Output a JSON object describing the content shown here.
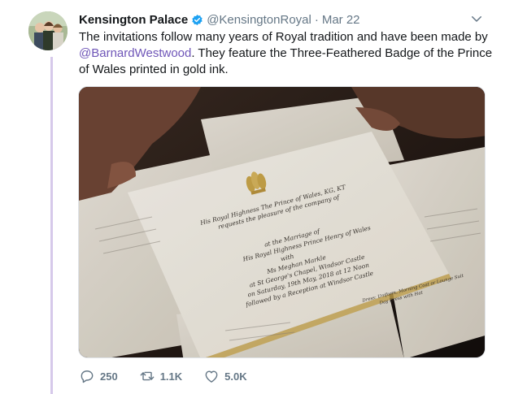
{
  "tweet": {
    "author_name": "Kensington Palace",
    "handle": "@KensingtonRoyal",
    "separator": "·",
    "date": "Mar 22",
    "text_before": "The invitations follow many years of Royal tradition and have been made by ",
    "mention": "@BarnardWestwood",
    "text_after": ". They feature the Three-Feathered Badge of the Prince of Wales printed in gold ink.",
    "verified_icon": "verified-badge-icon",
    "menu_icon": "chevron-down-icon"
  },
  "media": {
    "invitation_lines": [
      "His Royal Highness The Prince of Wales, KG, KT",
      "requests the pleasure of the company of",
      "at the Marriage of",
      "His Royal Highness Prince Henry of Wales",
      "with",
      "Ms Meghan Markle",
      "at St George's Chapel, Windsor Castle",
      "on Saturday, 19th May, 2018 at 12 Noon",
      "followed by a Reception at Windsor Castle",
      "Dress: Uniform, Morning Coat or Lounge Suit",
      "Day Dress with Hat"
    ]
  },
  "actions": {
    "reply_count": "250",
    "retweet_count": "1.1K",
    "like_count": "5.0K",
    "reply_icon": "reply-icon",
    "retweet_icon": "retweet-icon",
    "like_icon": "heart-icon"
  },
  "colors": {
    "mention": "#6f56b8",
    "thread_line": "#d6c9ea",
    "verified": "#1da1f2",
    "muted": "#657786"
  }
}
